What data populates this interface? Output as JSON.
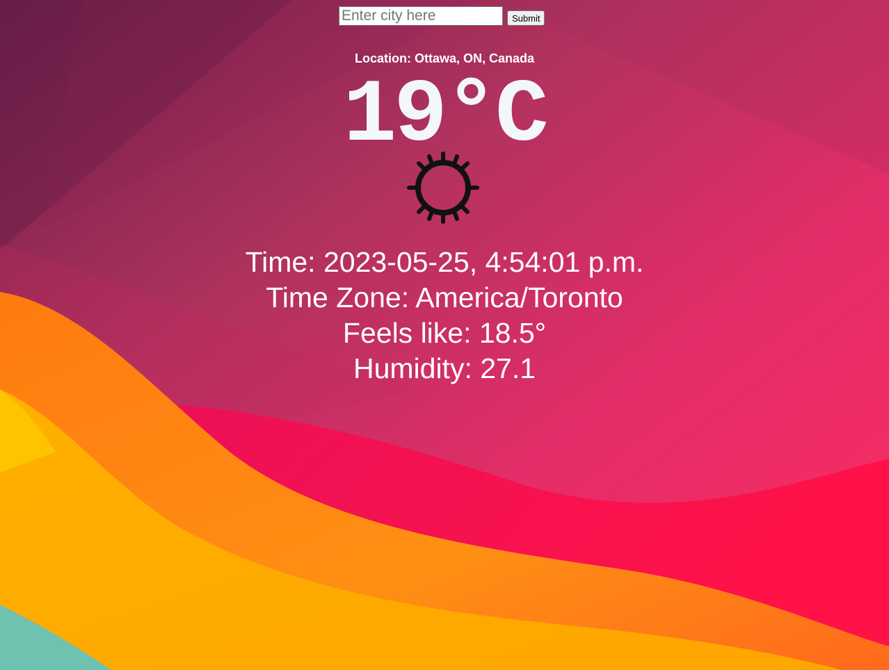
{
  "search": {
    "placeholder": "Enter city here",
    "value": "",
    "submit_label": "Submit"
  },
  "weather": {
    "location": "Location: Ottawa, ON, Canada",
    "temperature": "19°C",
    "condition_icon": "sun-icon",
    "time": "Time: 2023-05-25, 4:54:01 p.m.",
    "time_zone": "Time Zone: America/Toronto",
    "feels_like": "Feels like: 18.5°",
    "humidity": "Humidity: 27.1"
  },
  "colors": {
    "background_top": "#8a2451",
    "background_pink": "#f0245e",
    "wave_orange": "#ff9a1a",
    "wave_yellow": "#ffc21a",
    "wave_teal": "#6fc1b0",
    "text": "#ffffff",
    "temp_text": "#f3f7fb"
  }
}
